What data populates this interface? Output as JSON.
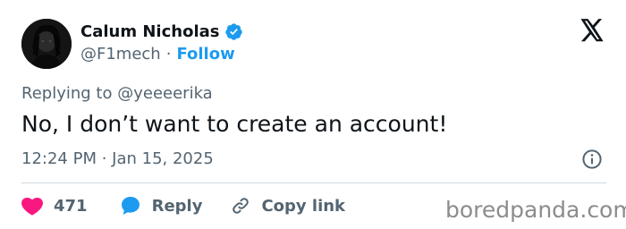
{
  "author": {
    "display_name": "Calum Nicholas",
    "handle": "@F1mech",
    "follow_label": "Follow",
    "separator": "·",
    "verified": true,
    "verified_color": "#1d9bf0"
  },
  "reply_context": {
    "prefix": "Replying to",
    "mention": "@yeeeerika"
  },
  "tweet": {
    "text": "No, I don’t want to create an account!",
    "timestamp": "12:24 PM · Jan 15, 2025"
  },
  "actions": {
    "like_count": "471",
    "reply_label": "Reply",
    "copy_link_label": "Copy link",
    "like_color": "#f91880",
    "reply_color": "#1d9bf0"
  },
  "icons": {
    "logo": "x-logo-icon",
    "verified": "verified-badge-icon",
    "info": "info-icon",
    "like": "heart-icon",
    "reply": "reply-bubble-icon",
    "copy": "link-icon"
  },
  "watermark": "boredpanda.com"
}
